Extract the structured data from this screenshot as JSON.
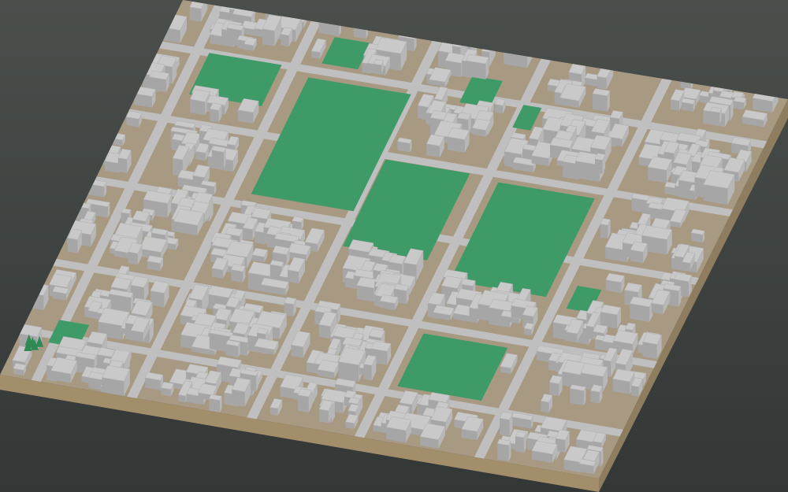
{
  "scene": {
    "type": "3d-city-block-model",
    "view": "isometric-oblique",
    "colors": {
      "background_top": "#4a4f4c",
      "background_bottom": "#333735",
      "ground": "#a89a82",
      "base_side": "#8f7d60",
      "base_front": "#a38e6c",
      "park": "#3e9a67",
      "park_dark": "#2f7f53",
      "building_roof": "#c9c9c9",
      "building_left": "#a6a6a6",
      "building_right": "#b7b7b7",
      "street": "#bfbfbf",
      "tree": "#2f8a55"
    },
    "features": [
      "parks",
      "buildings",
      "streets",
      "courtyards",
      "trees"
    ]
  }
}
